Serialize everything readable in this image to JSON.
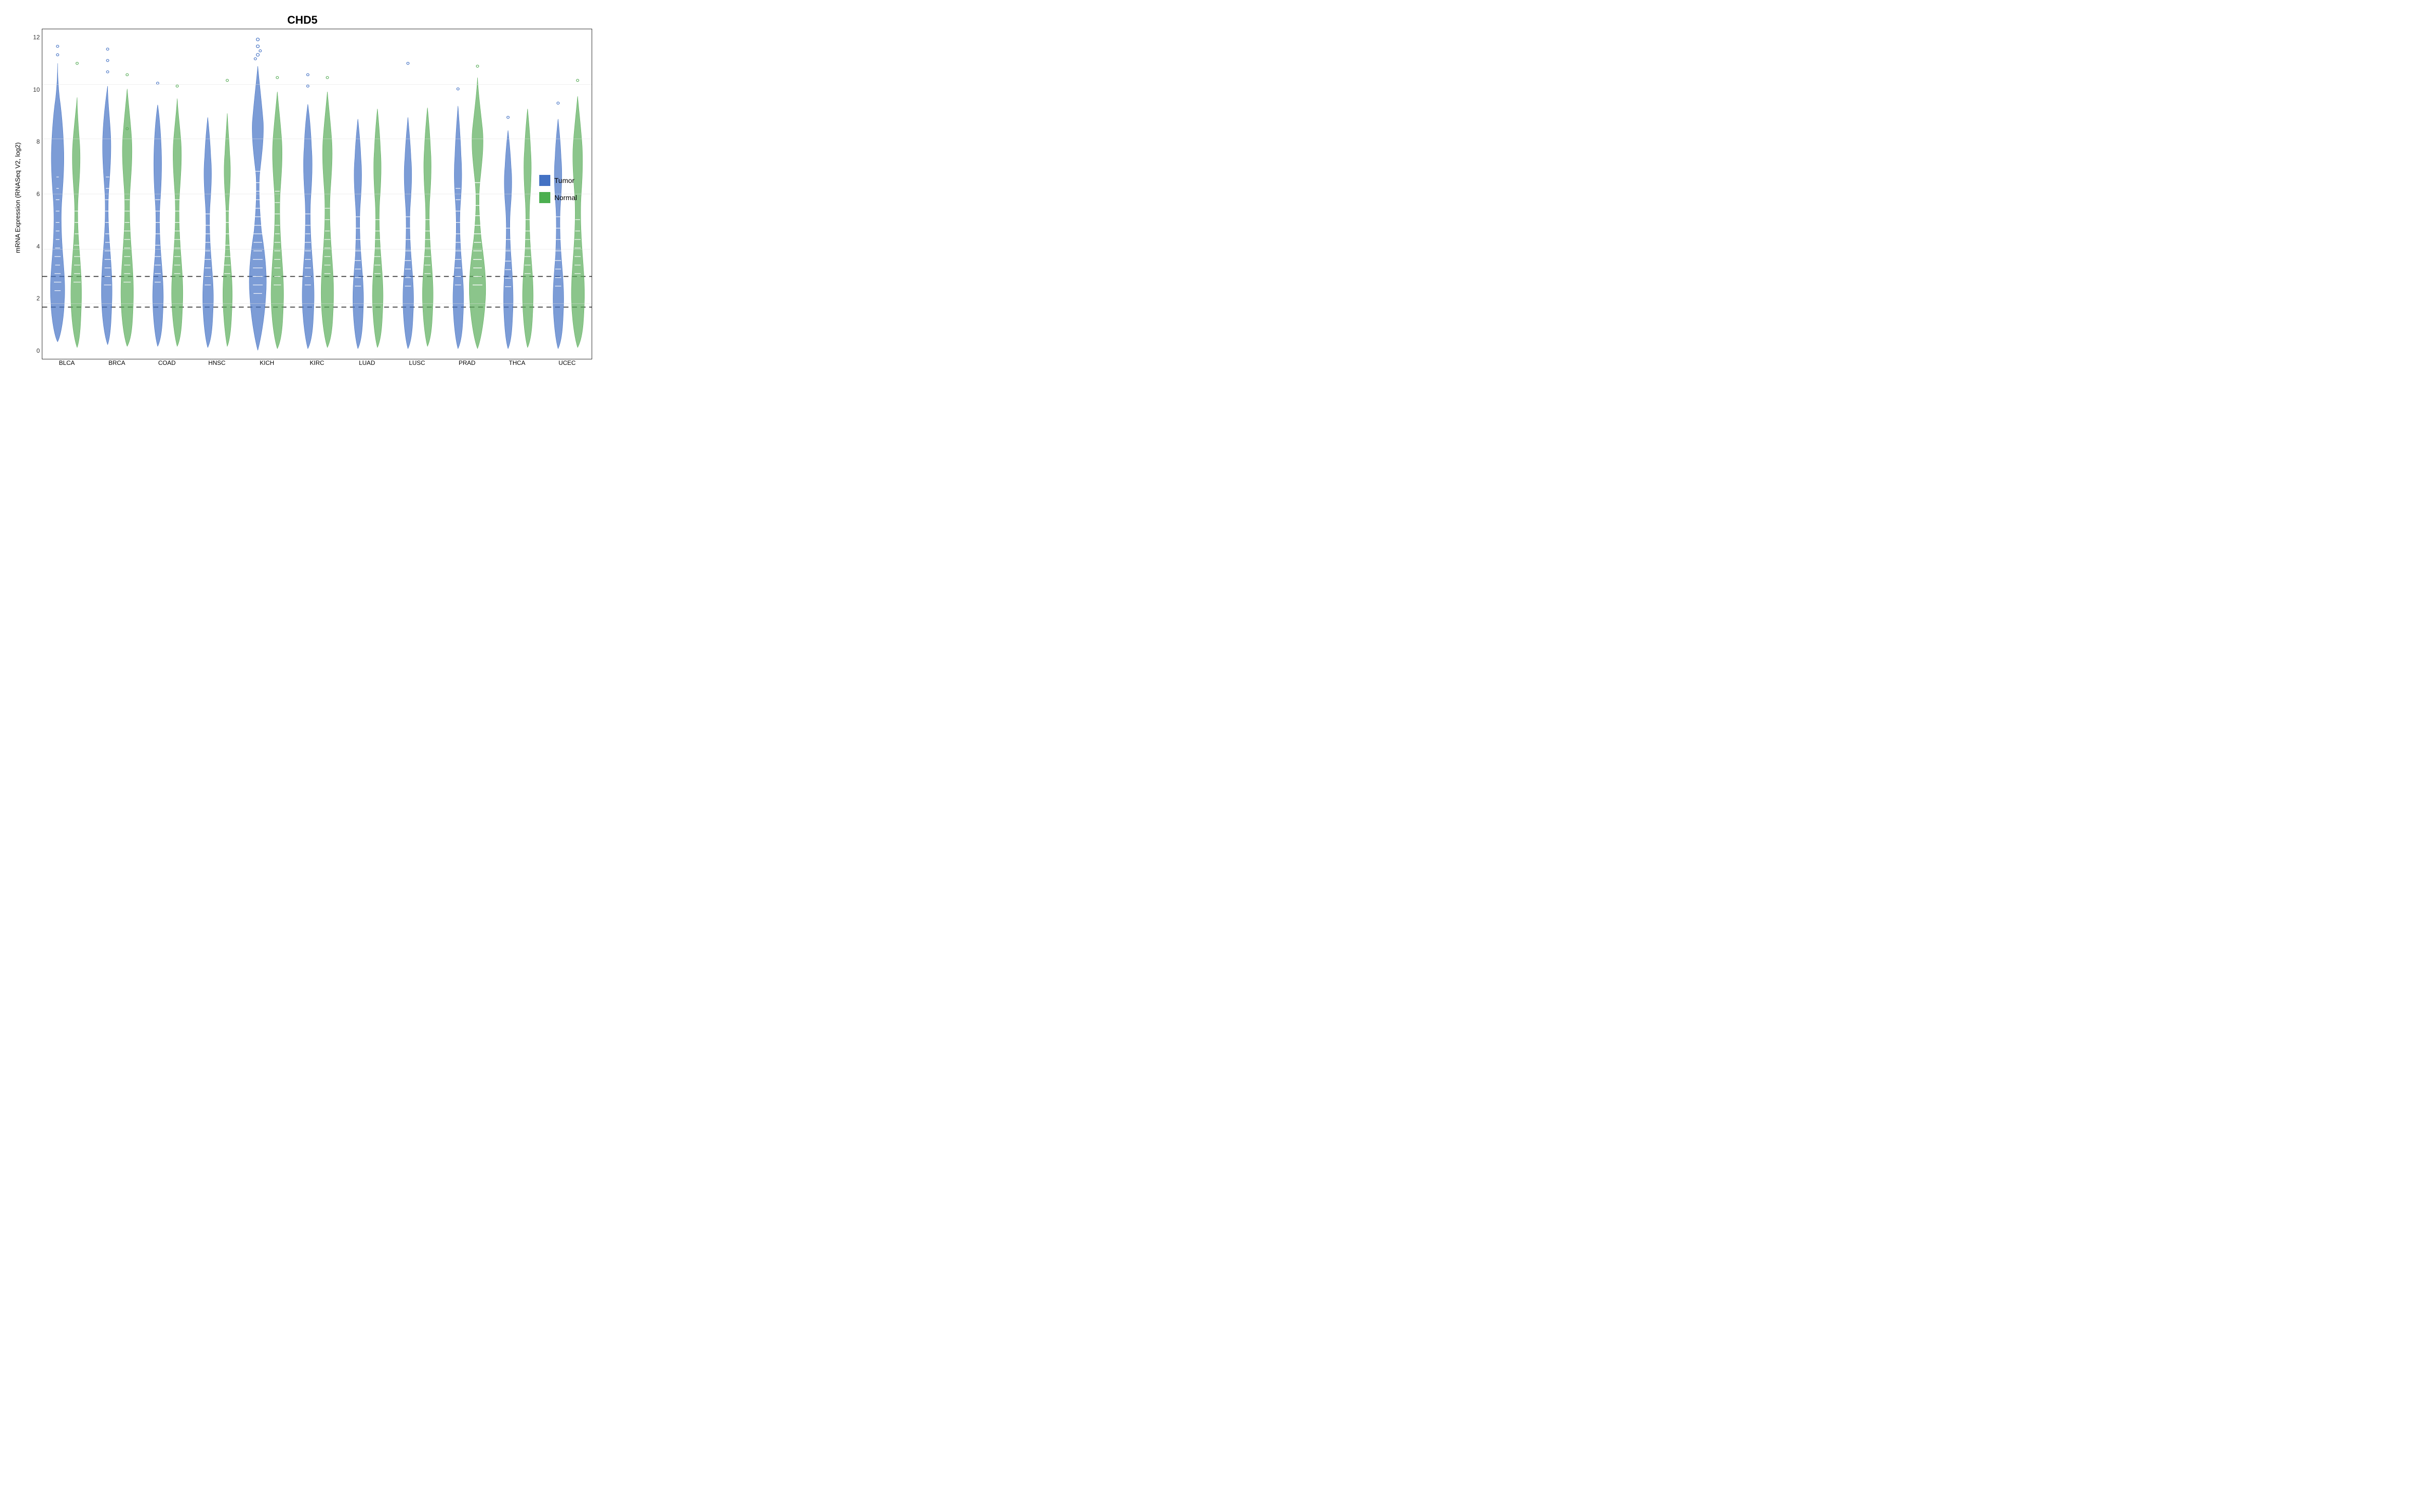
{
  "title": "CHD5",
  "yaxis_label": "mRNA Expression (RNASeq V2, log2)",
  "yaxis_ticks": [
    "12",
    "10",
    "8",
    "6",
    "4",
    "2",
    "0"
  ],
  "xaxis_labels": [
    "BLCA",
    "BRCA",
    "COAD",
    "HNSC",
    "KICH",
    "KIRC",
    "LUAD",
    "LUSC",
    "PRAD",
    "THCA",
    "UCEC"
  ],
  "legend": [
    {
      "label": "Tumor",
      "color": "#4472C4"
    },
    {
      "label": "Normal",
      "color": "#4CAF50"
    }
  ],
  "dotted_lines": [
    3.0,
    1.9
  ],
  "colors": {
    "tumor": "#4472C4",
    "normal": "#5aad5a",
    "border": "#333"
  }
}
